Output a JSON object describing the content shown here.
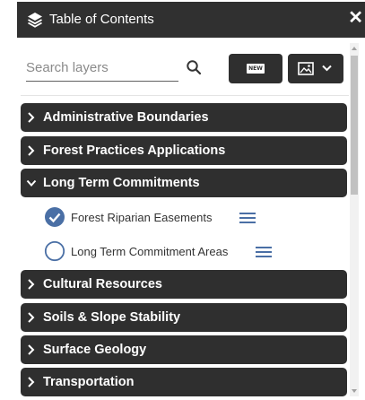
{
  "panel": {
    "title": "Table of Contents",
    "close_icon": "close-icon",
    "header_icon": "layers-icon",
    "header_bg": "#303030",
    "accent": "#4a6fa5"
  },
  "search": {
    "placeholder": "Search layers",
    "value": ""
  },
  "toolbar": {
    "new_label": "NEW",
    "basemap_icon": "image-icon"
  },
  "groups_top": [
    {
      "label": "Administrative Boundaries",
      "expanded": false
    },
    {
      "label": "Forest Practices Applications",
      "expanded": false
    },
    {
      "label": "Long Term Commitments",
      "expanded": true
    }
  ],
  "layers": [
    {
      "label": "Forest Riparian Easements",
      "checked": true
    },
    {
      "label": "Long Term Commitment Areas",
      "checked": false
    }
  ],
  "groups_bottom": [
    {
      "label": "Cultural Resources",
      "expanded": false
    },
    {
      "label": "Soils & Slope Stability",
      "expanded": false
    },
    {
      "label": "Surface Geology",
      "expanded": false
    },
    {
      "label": "Transportation",
      "expanded": false
    }
  ]
}
